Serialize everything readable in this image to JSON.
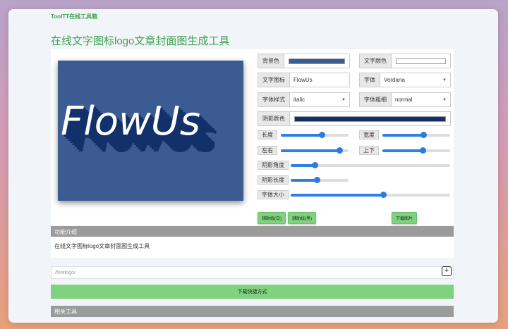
{
  "brand": "ToolTT在线工具箱",
  "page_title": "在线文字图标logo文章封面图生成工具",
  "preview": {
    "text": "FlowUs",
    "bg_color": "#3b5b92",
    "shadow_color": "#12306a",
    "text_color": "#ffffff"
  },
  "controls": {
    "bg_color_label": "背景色",
    "bg_color_value": "#3b5b92",
    "text_color_label": "文字颜色",
    "text_color_value": "#ffffff",
    "text_icon_label": "文字图标",
    "text_icon_value": "FlowUs",
    "font_label": "字体",
    "font_value": "Verdana",
    "font_style_label": "字体样式",
    "font_style_value": "italic",
    "font_weight_label": "字体粗细",
    "font_weight_value": "normal",
    "shadow_color_label": "阴影颜色",
    "shadow_color_value": "#12306a"
  },
  "sliders": {
    "length": {
      "label": "长度",
      "value": 0.6
    },
    "width": {
      "label": "宽度",
      "value": 0.6
    },
    "left_right": {
      "label": "左右",
      "value": 0.86
    },
    "up_down": {
      "label": "上下",
      "value": 0.59
    },
    "shadow_angle": {
      "label": "阴影角度",
      "value": 0.15
    },
    "shadow_length": {
      "label": "阴影长度",
      "value": 0.45
    },
    "font_size": {
      "label": "字体大小",
      "value": 0.58
    }
  },
  "buttons": {
    "guide_white": "辅助线(白)",
    "guide_black": "辅助线(黑)",
    "download_image": "下载图片",
    "download_shortcut": "下载快捷方式"
  },
  "intro": {
    "heading": "功能介绍",
    "text": "在线文字图标logo文章封面图生成工具"
  },
  "url_path": "/fontlogo/",
  "related_heading": "相关工具"
}
